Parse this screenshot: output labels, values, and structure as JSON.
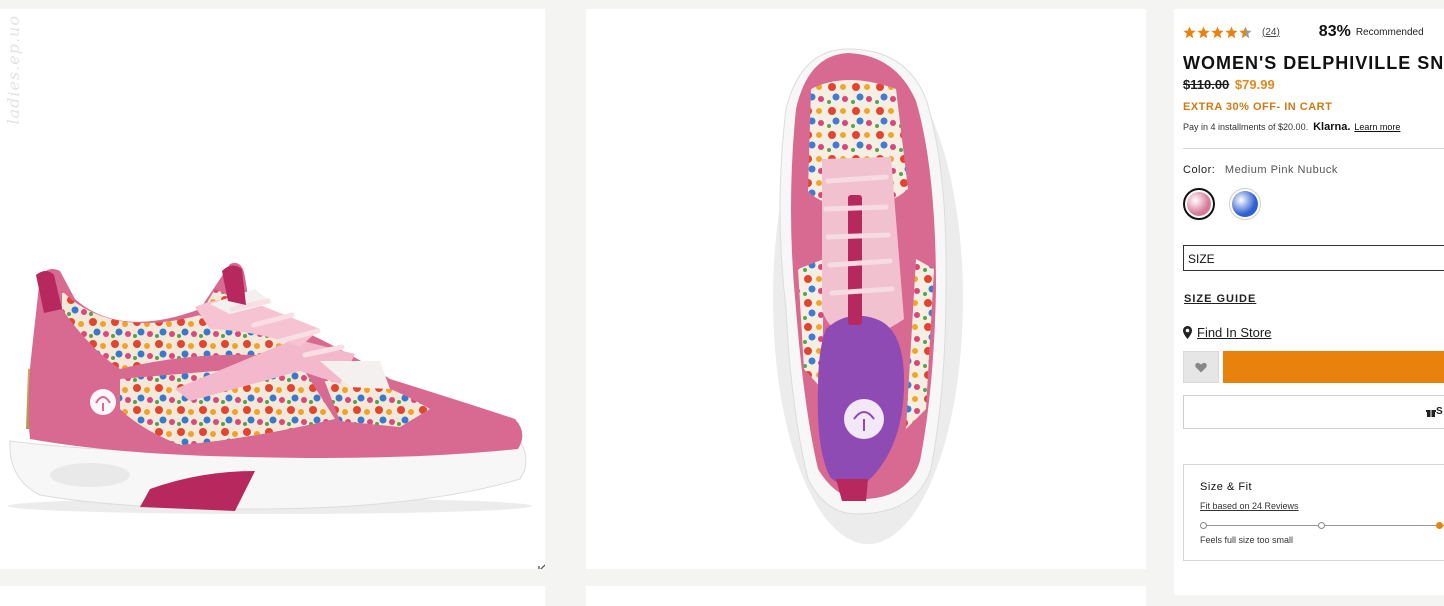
{
  "gallery": {
    "watermark": "ladies.ep.uo",
    "expand_icon": "expand-arrows-icon"
  },
  "product": {
    "rating_stars": 4.5,
    "review_count": "(24)",
    "recommended_pct": "83%",
    "recommended_label": "Recommended",
    "title": "WOMEN'S DELPHIVILLE SNEA",
    "old_price": "$110.00",
    "sale_price": "$79.99",
    "promo": "EXTRA 30% OFF- IN CART",
    "klarna_text": "Pay in 4 installments of $20.00.",
    "klarna_logo": "Klarna.",
    "klarna_learn_more": "Learn more",
    "color_label": "Color:",
    "color_value": "Medium Pink Nubuck",
    "swatches": [
      {
        "name": "Medium Pink Nubuck",
        "color": "#d77a9a",
        "selected": true
      },
      {
        "name": "Blue Floral",
        "color": "#2f5fd0",
        "selected": false
      }
    ],
    "size_placeholder": "SIZE",
    "size_guide": "SIZE GUIDE",
    "find_in_store": "Find In Store",
    "secondary_button_label": "S",
    "accent_color": "#e8820c"
  },
  "size_fit": {
    "title": "Size & Fit",
    "subtitle": "Fit based on 24 Reviews",
    "left_label": "Feels full size too small",
    "selected_point": 3
  }
}
